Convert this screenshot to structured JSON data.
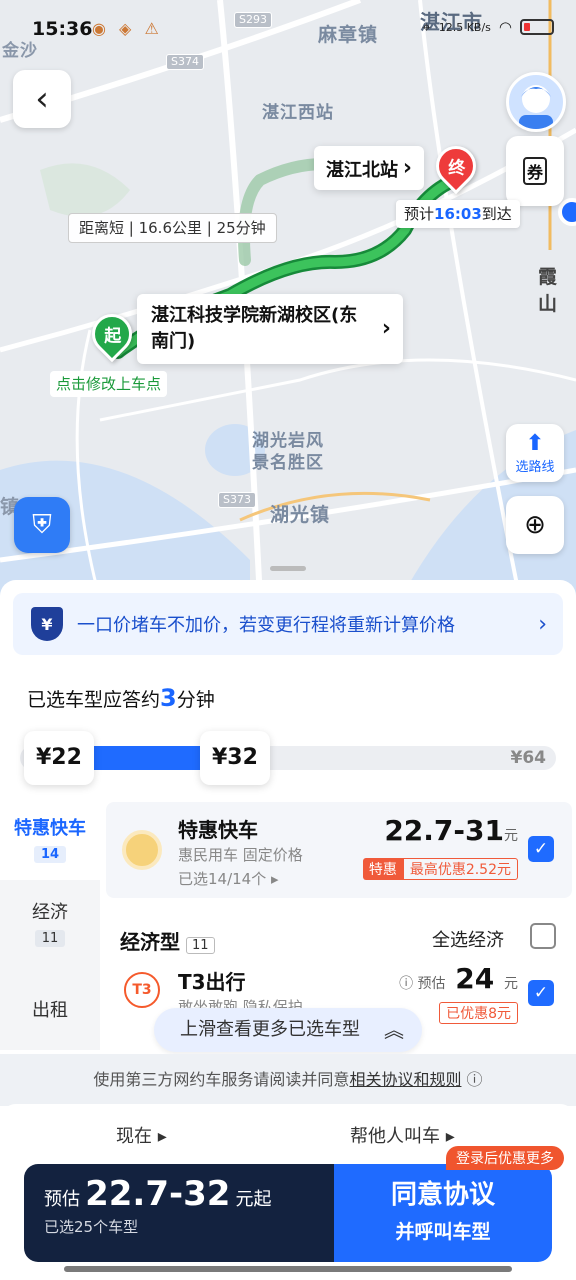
{
  "status": {
    "time": "15:36",
    "net_speed": "12.5 KB/s"
  },
  "map": {
    "labels": {
      "top_left_town": "金沙",
      "mazhang": "麻章镇",
      "zhanjiang_city": "湛江市",
      "west_station": "湛江西站",
      "xiashan": "霞山",
      "huguang_scenic": "湖光岩风景名胜区",
      "huguang_town": "湖光镇",
      "left_town": "镇"
    },
    "road_shields": [
      "S293",
      "S374",
      "S373"
    ],
    "dest_name": "湛江北站",
    "dest_pin": "终",
    "start_pin": "起",
    "start_name": "湛江科技学院新湖校区(东南门)",
    "distance_tip": "距离短 | 16.6公里 | 25分钟",
    "eta_prefix": "预计",
    "eta_time": "16:03",
    "eta_suffix": "到达",
    "pickup_hint": "点击修改上车点",
    "coupon_label": "券",
    "route_label": "选路线"
  },
  "notice": {
    "icon_text": "¥",
    "text": "一口价堵车不加价，若变更行程将重新计算价格"
  },
  "answer": {
    "prefix": "已选车型应答约",
    "minutes": "3",
    "suffix": "分钟"
  },
  "price_slider": {
    "low": "¥22",
    "selected": "¥32",
    "max": "¥64"
  },
  "side_tabs": [
    {
      "label": "特惠快车",
      "count": "14"
    },
    {
      "label": "经济",
      "count": "11"
    },
    {
      "label": "出租"
    }
  ],
  "special_card": {
    "name": "特惠快车",
    "sub": "惠民用车 固定价格",
    "selected_text": "已选14/14个",
    "price": "22.7-31",
    "unit": "元",
    "tag_a": "特惠",
    "tag_b": "最高优惠2.52元"
  },
  "economy": {
    "title": "经济型",
    "count": "11",
    "select_all": "全选经济"
  },
  "t3_card": {
    "name": "T3出行",
    "sub": "敢坐敢跑 隐私保护",
    "est_label": "预估",
    "price": "24",
    "unit": "元",
    "tag_b": "已优惠8元"
  },
  "more_pill": "上滑查看更多已选车型",
  "agree": {
    "prefix": "使用第三方网约车服务请阅读并同意",
    "link": "相关协议和规则"
  },
  "bottom": {
    "now": "现在",
    "help_call": "帮他人叫车",
    "est_label": "预估",
    "price_range": "22.7-32",
    "unit": "元起",
    "selected_count": "已选25个车型",
    "agree_btn": "同意协议",
    "call_btn": "并呼叫车型",
    "promo": "登录后优惠更多"
  },
  "colors": {
    "accent": "#1f6bff",
    "route": "#23a84a",
    "promo": "#f05a3a",
    "cta_dark": "#13223f"
  }
}
